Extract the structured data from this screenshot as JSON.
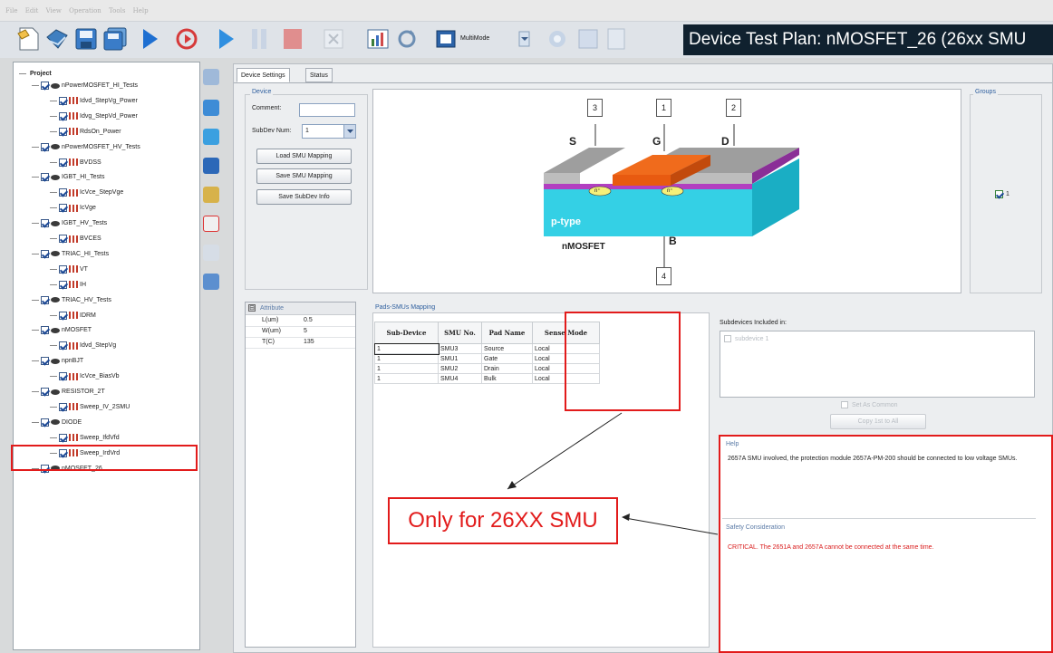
{
  "menu": [
    "File",
    "Edit",
    "View",
    "Operation",
    "Tools",
    "Help"
  ],
  "toolbar": {
    "multimode_label": "MultiMode"
  },
  "title_banner": "Device Test Plan: nMOSFET_26 (26xx SMU",
  "tree": {
    "root": "Project",
    "items": [
      {
        "label": "nPowerMOSFET_HI_Tests",
        "level": 1
      },
      {
        "label": "Idvd_StepVg_Power",
        "level": 2
      },
      {
        "label": "Idvg_StepVd_Power",
        "level": 2
      },
      {
        "label": "RdsOn_Power",
        "level": 2
      },
      {
        "label": "nPowerMOSFET_HV_Tests",
        "level": 1
      },
      {
        "label": "BVDSS",
        "level": 2
      },
      {
        "label": "IGBT_HI_Tests",
        "level": 1
      },
      {
        "label": "IcVce_StepVge",
        "level": 2
      },
      {
        "label": "IcVge",
        "level": 2
      },
      {
        "label": "IGBT_HV_Tests",
        "level": 1
      },
      {
        "label": "BVCES",
        "level": 2
      },
      {
        "label": "TRIAC_HI_Tests",
        "level": 1
      },
      {
        "label": "VT",
        "level": 2
      },
      {
        "label": "IH",
        "level": 2
      },
      {
        "label": "TRIAC_HV_Tests",
        "level": 1
      },
      {
        "label": "IDRM",
        "level": 2
      },
      {
        "label": "nMOSFET",
        "level": 1
      },
      {
        "label": "Idvd_StepVg",
        "level": 2
      },
      {
        "label": "npnBJT",
        "level": 1
      },
      {
        "label": "IcVce_BiasVb",
        "level": 2
      },
      {
        "label": "RESISTOR_2T",
        "level": 1
      },
      {
        "label": "Sweep_IV_2SMU",
        "level": 2
      },
      {
        "label": "DIODE",
        "level": 1
      },
      {
        "label": "Sweep_IfdVfd",
        "level": 2
      },
      {
        "label": "Sweep_IrdVrd",
        "level": 2
      },
      {
        "label": "nMOSFET_26",
        "level": 1
      }
    ]
  },
  "tabs": {
    "device_settings": "Device Settings",
    "status": "Status"
  },
  "device": {
    "group_label": "Device",
    "comment_label": "Comment:",
    "comment_value": "",
    "subdev_label": "SubDev Num:",
    "subdev_value": "1",
    "btn_load": "Load SMU Mapping",
    "btn_save": "Save SMU Mapping",
    "btn_save_subdev": "Save SubDev Info"
  },
  "diagram": {
    "pin_s": "3",
    "pin_g": "1",
    "pin_d": "2",
    "pin_b": "4",
    "label_s": "S",
    "label_g": "G",
    "label_d": "D",
    "label_b": "B",
    "n_plus": "n⁺",
    "substrate": "p-type",
    "caption": "nMOSFET"
  },
  "groups": {
    "label": "Groups",
    "checkbox_label": "1"
  },
  "attributes": {
    "header": "Attribute",
    "rows": [
      {
        "name": "L(um)",
        "value": "0.5"
      },
      {
        "name": "W(um)",
        "value": "5"
      },
      {
        "name": "T(C)",
        "value": "135"
      }
    ]
  },
  "mapping": {
    "label": "Pads-SMUs Mapping",
    "columns": [
      "Sub-Device",
      "SMU No.",
      "Pad Name",
      "Sense Mode"
    ],
    "rows": [
      [
        "1",
        "SMU3",
        "Source",
        "Local"
      ],
      [
        "1",
        "SMU1",
        "Gate",
        "Local"
      ],
      [
        "1",
        "SMU2",
        "Drain",
        "Local"
      ],
      [
        "1",
        "SMU4",
        "Bulk",
        "Local"
      ]
    ]
  },
  "subdevices": {
    "label": "Subdevices Included in:",
    "items": [
      "subdevice 1"
    ],
    "set_common": "Set As Common",
    "copy_btn": "Copy 1st to All"
  },
  "help": {
    "title": "Help",
    "text": "2657A SMU involved, the protection module 2657A-PM-200 should be connected to low voltage SMUs.",
    "safety_title": "Safety Consideration",
    "safety_text": "CRITICAL. The 2651A and 2657A cannot be connected at the same time."
  },
  "annotation": {
    "text": "Only for 26XX SMU"
  },
  "colors": {
    "annotation_red": "#e21b1b",
    "banner_bg": "#10212f",
    "oxide_orange": "#f06b1c",
    "substrate_cyan": "#34d0e5",
    "nwell_magenta": "#b23fc0"
  }
}
